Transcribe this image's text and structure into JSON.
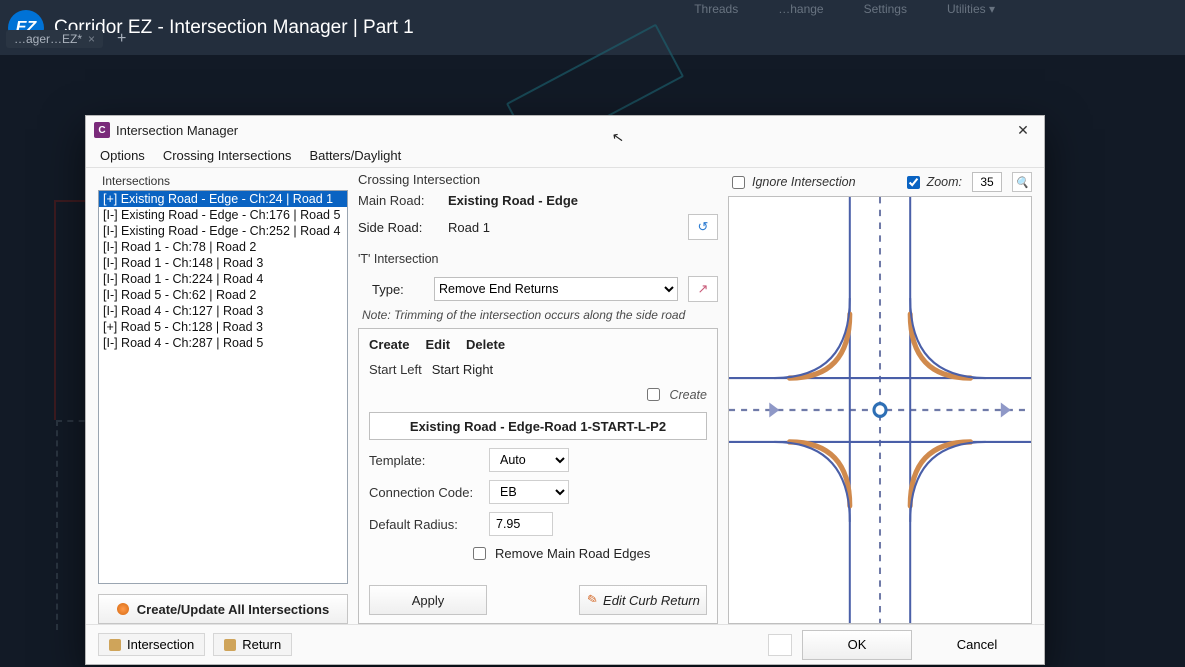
{
  "app": {
    "logo": "EZ",
    "title": "Corridor EZ - Intersection Manager | Part 1",
    "tab_name": "…ager…EZ*",
    "ribbon": {
      "threads": "Threads",
      "change": "…hange",
      "settings": "Settings",
      "utilities": "Utilities ▾"
    }
  },
  "dialog": {
    "title": "Intersection Manager",
    "menu": {
      "options": "Options",
      "crossing": "Crossing Intersections",
      "batters": "Batters/Daylight"
    },
    "intersections_label": "Intersections",
    "intersections": [
      "[+] Existing Road - Edge - Ch:24 | Road 1",
      "[I-] Existing Road - Edge - Ch:176 | Road 5",
      "[I-] Existing Road - Edge - Ch:252 | Road 4",
      "[I-] Road 1 - Ch:78 | Road 2",
      "[I-] Road 1 - Ch:148 | Road 3",
      "[I-] Road 1 - Ch:224 | Road 4",
      "[I-] Road 5 - Ch:62 | Road 2",
      "[I-] Road 4 - Ch:127 | Road 3",
      "[+] Road 5 - Ch:128 | Road 3",
      "[I-] Road 4 - Ch:287 | Road 5"
    ],
    "create_all": "Create/Update All Intersections",
    "crossing": {
      "header": "Crossing Intersection",
      "main_road_label": "Main Road:",
      "main_road_value": "Existing Road - Edge",
      "side_road_label": "Side Road:",
      "side_road_value": "Road 1",
      "t_label": "'T' Intersection",
      "type_label": "Type:",
      "type_value": "Remove End Returns",
      "note": "Note: Trimming of the intersection occurs along the side road"
    },
    "editpanel": {
      "create": "Create",
      "edit": "Edit",
      "delete": "Delete",
      "start_left": "Start Left",
      "start_right": "Start Right",
      "create_chk": "Create",
      "combo": "Existing Road - Edge-Road 1-START-L-P2",
      "template_label": "Template:",
      "template_value": "Auto",
      "conn_label": "Connection Code:",
      "conn_value": "EB",
      "radius_label": "Default Radius:",
      "radius_value": "7.95",
      "remove_edges": "Remove Main Road Edges",
      "apply": "Apply",
      "edit_curb": "Edit Curb Return"
    },
    "right": {
      "ignore": "Ignore Intersection",
      "zoom_label": "Zoom:",
      "zoom_value": "35"
    },
    "footer": {
      "intersection": "Intersection",
      "return": "Return",
      "ok": "OK",
      "cancel": "Cancel"
    }
  }
}
